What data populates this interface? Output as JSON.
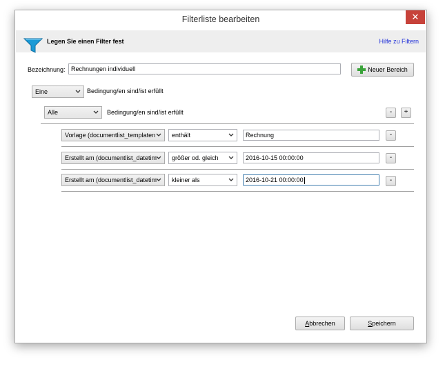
{
  "window": {
    "title": "Filterliste bearbeiten",
    "close": "✕"
  },
  "header": {
    "title": "Legen Sie einen Filter fest",
    "help_link": "Hilfe zu Filtern"
  },
  "name_row": {
    "label": "Bezeichnung:",
    "value": "Rechnungen individuell",
    "new_range_button": "Neuer Bereich"
  },
  "outer_group": {
    "quantifier": "Eine",
    "text": "Bedingung/en sind/ist erfüllt"
  },
  "inner_group": {
    "quantifier": "Alle",
    "text": "Bedingung/en sind/ist erfüllt",
    "remove": "-",
    "add": "+"
  },
  "conditions": [
    {
      "field": "Vorlage (documentlist_templaten",
      "operator": "enthält",
      "value": "Rechnung",
      "remove": "-"
    },
    {
      "field": "Erstellt am (documentlist_datetim",
      "operator": "größer od. gleich",
      "value": "2016-10-15 00:00:00",
      "remove": "-"
    },
    {
      "field": "Erstellt am (documentlist_datetim",
      "operator": "kleiner als",
      "value": "2016-10-21 00:00:00",
      "remove": "-"
    }
  ],
  "footer": {
    "cancel": {
      "first": "A",
      "rest": "bbrechen"
    },
    "save": {
      "first": "S",
      "rest": "peichern"
    }
  },
  "icons": {
    "funnel": "funnel-icon",
    "plus": "plus-icon",
    "close": "close-icon",
    "chevron": "chevron-down-icon"
  },
  "colors": {
    "close_red": "#c7423a",
    "link_blue": "#1f2fd8",
    "funnel_blue": "#1a9ad6",
    "plus_green": "#3aa33a"
  }
}
